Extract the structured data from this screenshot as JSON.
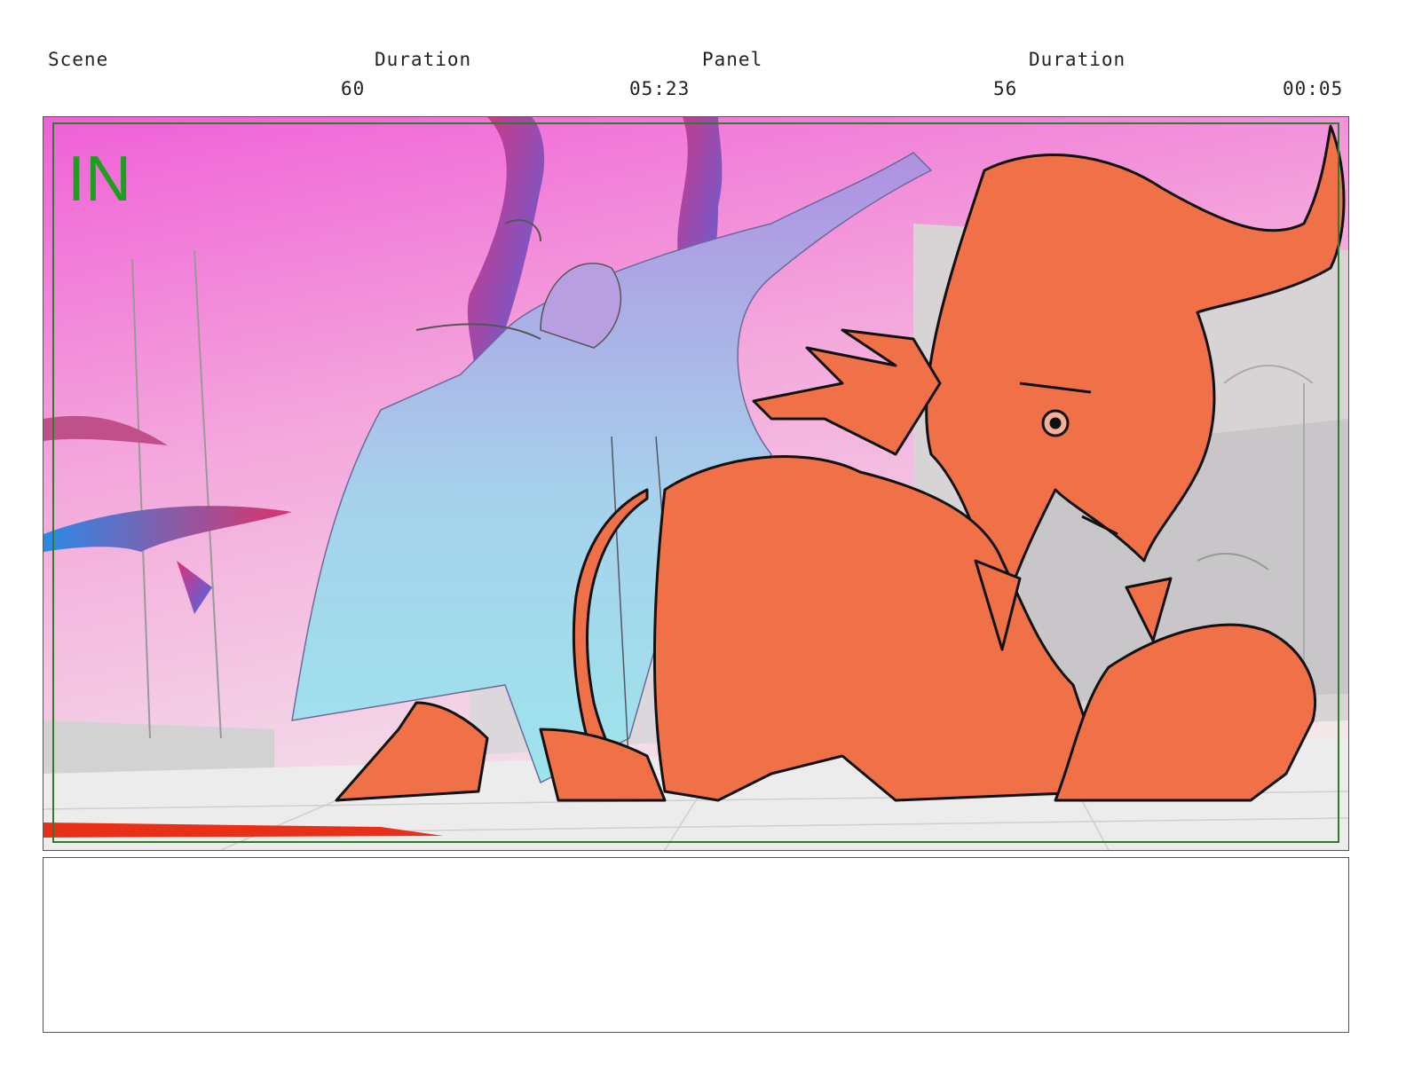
{
  "header": {
    "scene_label": "Scene",
    "scene_duration_label": "Duration",
    "panel_label": "Panel",
    "panel_duration_label": "Duration",
    "scene_number": "60",
    "scene_duration": "05:23",
    "panel_number": "56",
    "panel_duration": "00:05"
  },
  "panel": {
    "marker_text": "IN",
    "marker_color": "#1aa01a",
    "safe_frame_color": "#2e7d2e",
    "character_fill": "#f07048",
    "sky_top_color": "#f060d8",
    "sky_bottom_color": "#f5e8ea",
    "wing_gradient_top": "#b090e0",
    "wing_gradient_bottom": "#9ee4ec"
  },
  "notes": {
    "text": ""
  }
}
